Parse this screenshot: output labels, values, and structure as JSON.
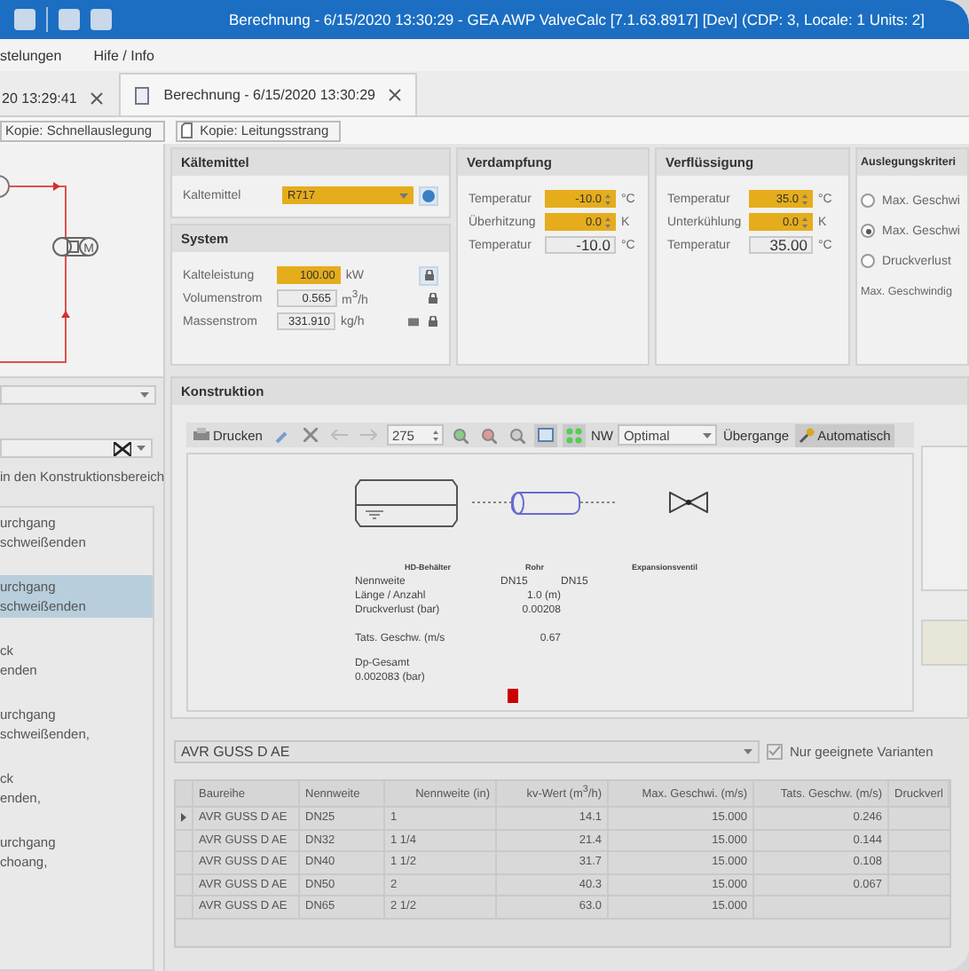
{
  "title_bar": {
    "title": "Berechnung - 6/15/2020 13:30:29 - GEA AWP ValveCalc [7.1.63.8917] [Dev] (CDP: 3, Locale: 1 Units: 2]"
  },
  "menu": [
    {
      "label": "stelungen"
    },
    {
      "label": "Hife / Info"
    }
  ],
  "tabs": [
    {
      "label": "20 13:29:41",
      "selected": false
    },
    {
      "label": "Berechnung - 6/15/2020 13:30:29",
      "selected": true
    }
  ],
  "copy_buttons": [
    {
      "label": "Kopie: Schnellauslegung"
    },
    {
      "label": "Kopie: Leitungsstrang"
    }
  ],
  "left": {
    "schematic": {
      "motor_label": "M"
    },
    "hint": "in den Konstruktionsbereich",
    "list": [
      {
        "lines": [
          "urchgang",
          "schweißenden"
        ],
        "selected": false
      },
      {
        "lines": [
          "urchgang",
          "schweißenden"
        ],
        "selected": true
      },
      {
        "lines": [
          "ck",
          "enden"
        ],
        "selected": false
      },
      {
        "lines": [
          "urchgang",
          "schweißenden,"
        ],
        "selected": false
      },
      {
        "lines": [
          "ck",
          "enden,"
        ],
        "selected": false
      },
      {
        "lines": [
          "urchgang",
          "choang,"
        ],
        "selected": false
      }
    ]
  },
  "refrigerant": {
    "title": "Kältemittel",
    "label": "Kaltemittel",
    "value": "R717"
  },
  "system": {
    "title": "System",
    "rows": [
      {
        "label": "Kalteleistung",
        "value": "100.00",
        "unit": "kW",
        "kind": "input"
      },
      {
        "label": "Volumenstrom",
        "value": "0.565",
        "unit": "m$^{3}$/h",
        "kind": "readonly"
      },
      {
        "label": "Massenstrom",
        "value": "331.910",
        "unit": "kg/h",
        "kind": "readonly"
      }
    ]
  },
  "evaporation": {
    "title": "Verdampfung",
    "rows": [
      {
        "label": "Temperatur",
        "value": "-10.0",
        "unit": "°C",
        "kind": "spin"
      },
      {
        "label": "Überhitzung",
        "value": "0.0",
        "unit": "K",
        "kind": "spin"
      },
      {
        "label": "Temperatur",
        "value": "-10.0",
        "unit": "°C",
        "kind": "readonly"
      }
    ]
  },
  "condensation": {
    "title": "Verflüssigung",
    "rows": [
      {
        "label": "Temperatur",
        "value": "35.0",
        "unit": "°C",
        "kind": "spin"
      },
      {
        "label": "Unterkühlung",
        "value": "0.0",
        "unit": "K",
        "kind": "spin"
      },
      {
        "label": "Temperatur",
        "value": "35.00",
        "unit": "°C",
        "kind": "readonly"
      }
    ]
  },
  "criteria": {
    "title": "Auslegungskriteri",
    "options": [
      {
        "label": "Max. Geschwi",
        "selected": false
      },
      {
        "label": "Max. Geschwi",
        "selected": true
      },
      {
        "label": "Druckverlust",
        "selected": false
      }
    ],
    "note": "Max. Geschwindig"
  },
  "construction": {
    "title": "Konstruktion",
    "toolbar": {
      "print": "Drucken",
      "zoom": "275",
      "nw_label": "NW",
      "nw_value": "Optimal",
      "transition": "Übergange",
      "auto": "Automatisch",
      "auto_active": true
    },
    "diagram": {
      "headers": [
        "HD-Behälter",
        "Rohr",
        "Expansionsventil"
      ],
      "rows": [
        {
          "label": "Nennweite",
          "values": [
            "DN15",
            "DN15"
          ]
        },
        {
          "label": "Länge / Anzahl",
          "values": [
            "1.0 (m)"
          ]
        },
        {
          "label": "Druckverlust (bar)",
          "values": [
            "0.00208"
          ]
        },
        {
          "label": "Tats. Geschw. (m/s",
          "values": [
            "0.67"
          ]
        }
      ],
      "total_label": "Dp-Gesamt",
      "total_value": "0.002083 (bar)"
    }
  },
  "variant": {
    "value": "AVR GUSS D AE",
    "filter_label": "Nur geeignete Varianten",
    "filter_checked": true
  },
  "table": {
    "columns": [
      "Baureihe",
      "Nennweite",
      "Nennweite (in)",
      "kv-Wert (m$^{3}$/h)",
      "Max. Geschwi. (m/s)",
      "Tats. Geschw. (m/s)",
      "Druckverl"
    ],
    "rows": [
      {
        "current": true,
        "cells": [
          "AVR GUSS D AE",
          "DN25",
          "1",
          "14.1",
          "15.000",
          "0.246"
        ]
      },
      {
        "current": false,
        "cells": [
          "AVR GUSS D AE",
          "DN32",
          "1 1/4",
          "21.4",
          "15.000",
          "0.144"
        ]
      },
      {
        "current": false,
        "cells": [
          "AVR GUSS D AE",
          "DN40",
          "1 1/2",
          "31.7",
          "15.000",
          "0.108"
        ]
      },
      {
        "current": false,
        "cells": [
          "AVR GUSS D AE",
          "DN50",
          "2",
          "40.3",
          "15.000",
          "0.067"
        ]
      },
      {
        "current": false,
        "cells": [
          "AVR GUSS D AE",
          "DN65",
          "2 1/2",
          "63.0",
          "15.000"
        ]
      }
    ]
  }
}
